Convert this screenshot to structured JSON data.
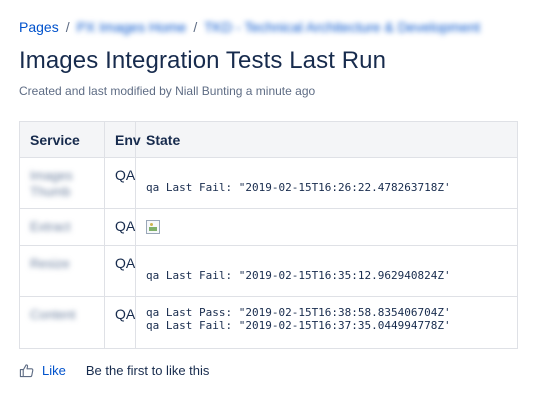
{
  "breadcrumb": {
    "items": [
      {
        "label": "Pages",
        "blurred": false
      },
      {
        "label": "PX Images Home",
        "blurred": true
      },
      {
        "label": "TKD - Technical Architecture & Development",
        "blurred": true
      }
    ],
    "separator": "/"
  },
  "page": {
    "title": "Images Integration Tests Last Run",
    "byline": "Created and last modified by Niall Bunting a minute ago"
  },
  "table": {
    "headers": {
      "service": "Service",
      "env": "Env",
      "state": "State"
    },
    "rows": [
      {
        "service": "Images Thumb",
        "env": "QA",
        "state": [
          "qa Last Fail: \"2019-02-15T16:26:22.478263718Z'"
        ]
      },
      {
        "service": "Extract",
        "env": "QA",
        "state": [],
        "broken_image": true
      },
      {
        "service": "Resize",
        "env": "QA",
        "state": [
          "qa Last Fail: \"2019-02-15T16:35:12.962940824Z'"
        ]
      },
      {
        "service": "Content",
        "env": "QA",
        "state": [
          "qa Last Pass: \"2019-02-15T16:38:58.835406704Z'",
          "qa Last Fail: \"2019-02-15T16:37:35.044994778Z'"
        ]
      }
    ]
  },
  "footer": {
    "like_label": "Like",
    "like_note": "Be the first to like this"
  },
  "colors": {
    "link": "#0052cc",
    "text": "#172b4d",
    "muted": "#5e6c84",
    "header_bg": "#f4f5f7",
    "border": "#dfe1e6"
  },
  "icons": {
    "like": "thumbs-up-icon",
    "broken_image": "broken-image-icon"
  }
}
